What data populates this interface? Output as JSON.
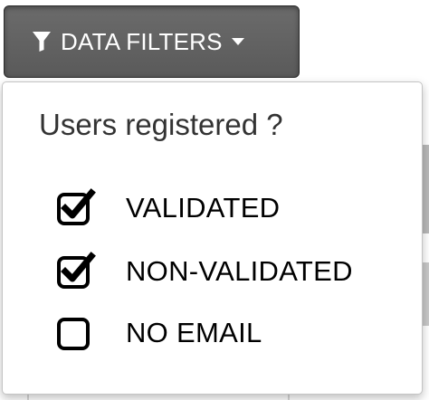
{
  "toolbar": {
    "filters_label": "DATA FILTERS",
    "button_color": "#5f5f5f"
  },
  "filters_menu": {
    "title": "Users registered ?",
    "options": [
      {
        "label": "VALIDATED",
        "checked": true
      },
      {
        "label": "NON-VALIDATED",
        "checked": true
      },
      {
        "label": "NO EMAIL",
        "checked": false
      }
    ]
  }
}
